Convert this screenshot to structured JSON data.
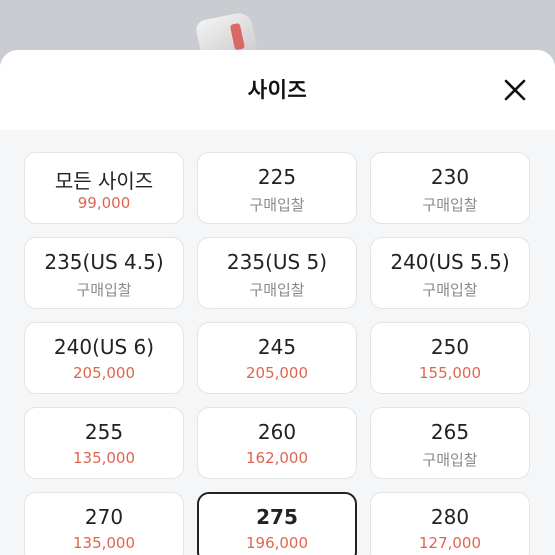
{
  "sheet": {
    "title": "사이즈"
  },
  "colors": {
    "price": "#e0654f",
    "bid": "#8a8a8a",
    "selected_border": "#222222"
  },
  "icons": {
    "close": "close-icon"
  },
  "sizes": [
    {
      "size": "모든 사이즈",
      "sub": "99,000",
      "kind": "price",
      "selected": false
    },
    {
      "size": "225",
      "sub": "구매입찰",
      "kind": "bid",
      "selected": false
    },
    {
      "size": "230",
      "sub": "구매입찰",
      "kind": "bid",
      "selected": false
    },
    {
      "size": "235(US 4.5)",
      "sub": "구매입찰",
      "kind": "bid",
      "selected": false
    },
    {
      "size": "235(US 5)",
      "sub": "구매입찰",
      "kind": "bid",
      "selected": false
    },
    {
      "size": "240(US 5.5)",
      "sub": "구매입찰",
      "kind": "bid",
      "selected": false
    },
    {
      "size": "240(US 6)",
      "sub": "205,000",
      "kind": "price",
      "selected": false
    },
    {
      "size": "245",
      "sub": "205,000",
      "kind": "price",
      "selected": false
    },
    {
      "size": "250",
      "sub": "155,000",
      "kind": "price",
      "selected": false
    },
    {
      "size": "255",
      "sub": "135,000",
      "kind": "price",
      "selected": false
    },
    {
      "size": "260",
      "sub": "162,000",
      "kind": "price",
      "selected": false
    },
    {
      "size": "265",
      "sub": "구매입찰",
      "kind": "bid",
      "selected": false
    },
    {
      "size": "270",
      "sub": "135,000",
      "kind": "price",
      "selected": false
    },
    {
      "size": "275",
      "sub": "196,000",
      "kind": "price",
      "selected": true
    },
    {
      "size": "280",
      "sub": "127,000",
      "kind": "price",
      "selected": false
    }
  ]
}
